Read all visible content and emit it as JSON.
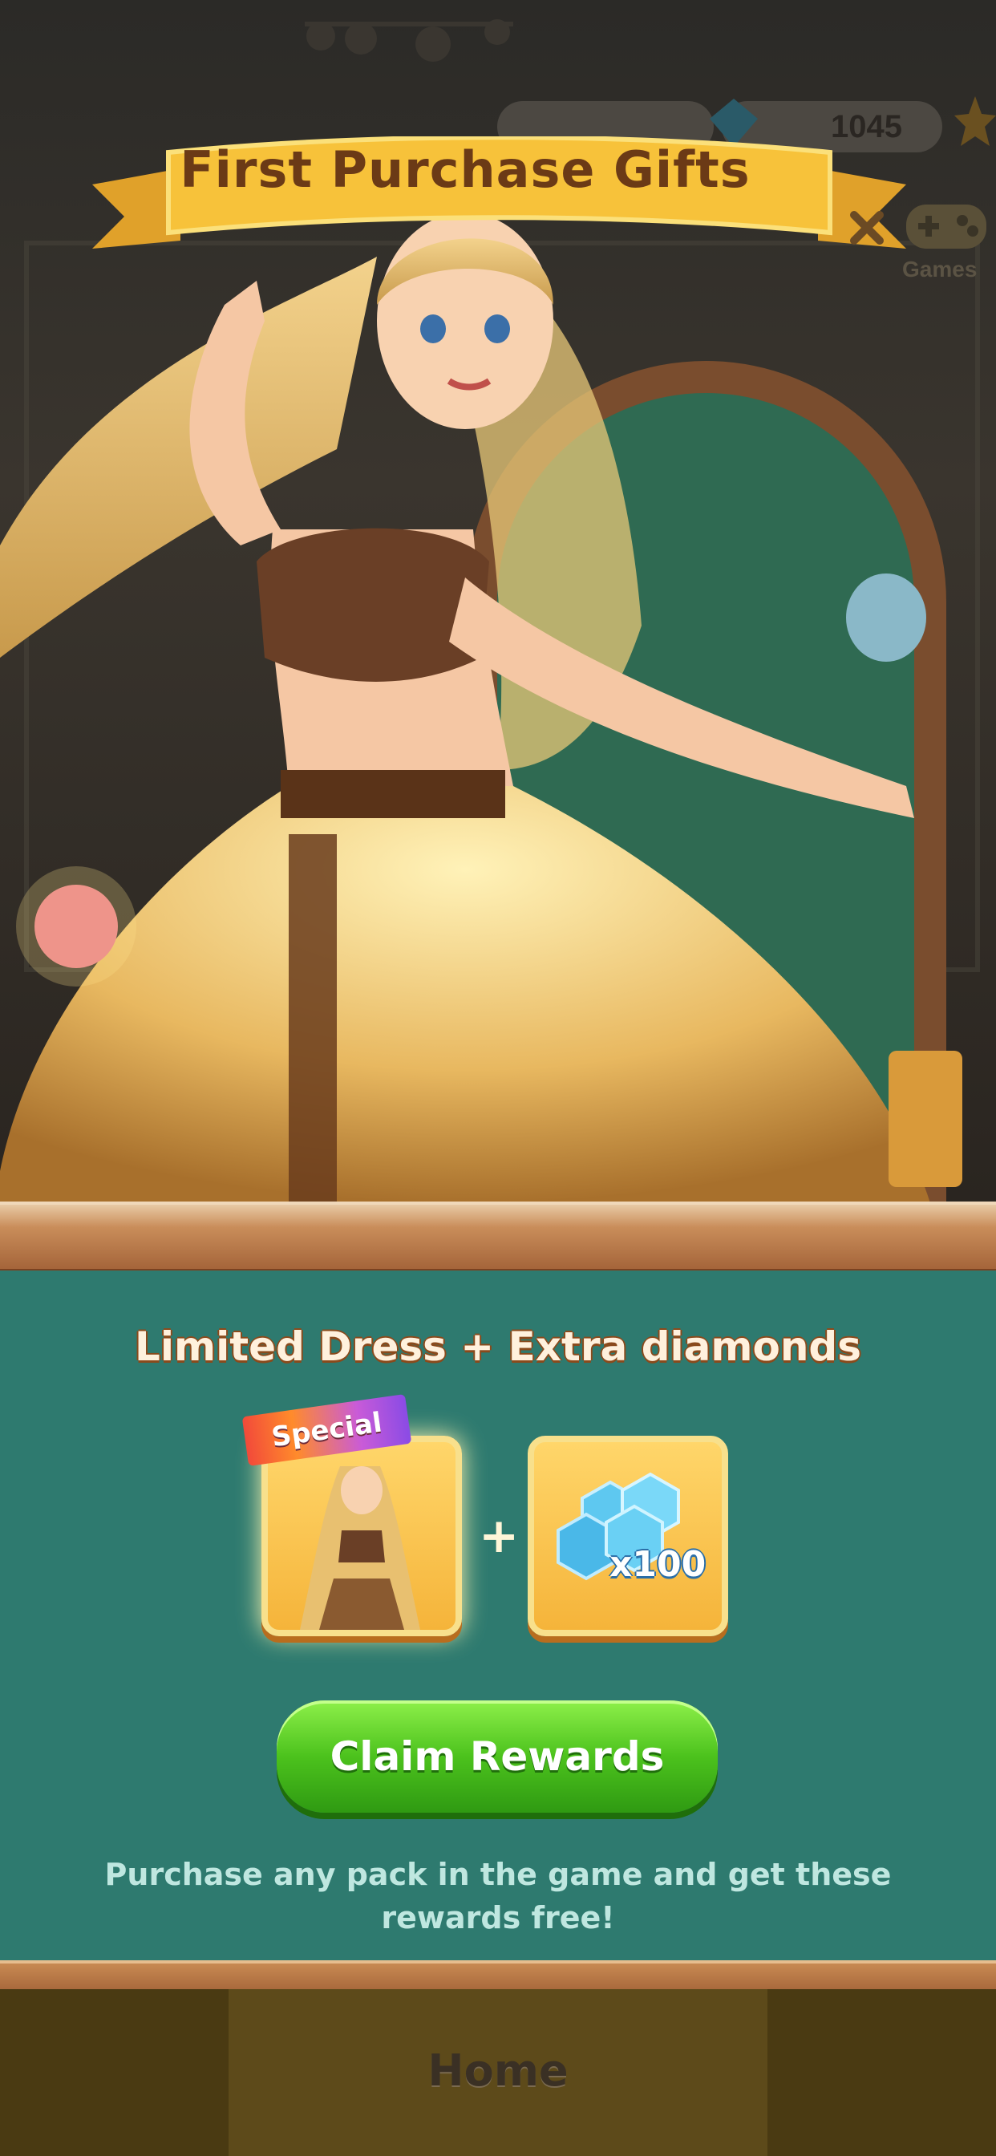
{
  "hud": {
    "diamond_count": "1045",
    "games_label": "Games"
  },
  "popup": {
    "title": "First Purchase Gifts",
    "heading": "Limited Dress + Extra diamonds",
    "special_tag": "Special",
    "plus": "+",
    "diamond_reward": "x100",
    "claim_button": "Claim Rewards",
    "note": "Purchase any pack in the game and get these rewards free!"
  },
  "nav": {
    "home_label": "Home"
  },
  "colors": {
    "panel": "#2e7a6f",
    "banner": "#f7c23a",
    "button_green": "#4cc21d",
    "title_brown": "#6b3a16"
  }
}
